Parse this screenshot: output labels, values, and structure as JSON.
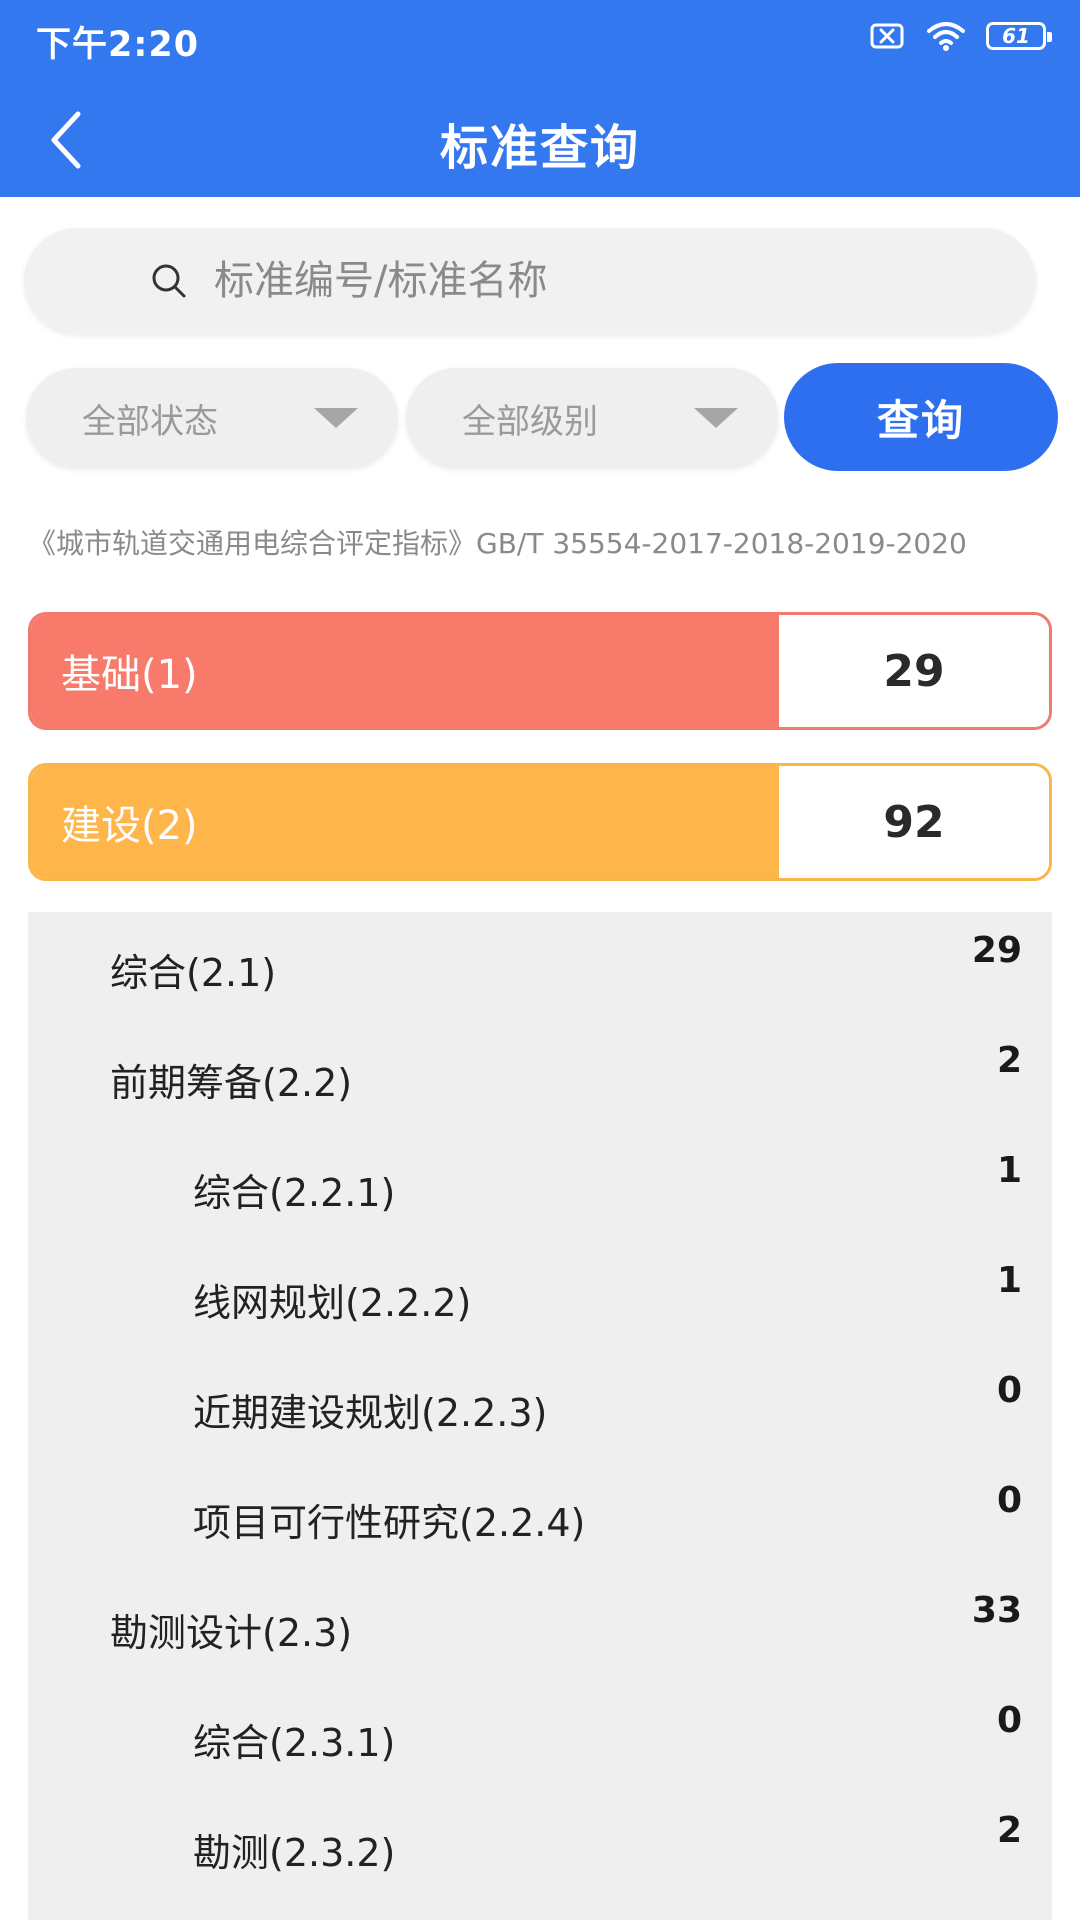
{
  "status_bar": {
    "time": "下午2:20",
    "battery": "61"
  },
  "header": {
    "title": "标准查询"
  },
  "search": {
    "placeholder": "标准编号/标准名称",
    "value": ""
  },
  "filters": {
    "status_label": "全部状态",
    "level_label": "全部级别",
    "query_label": "查询"
  },
  "standard_name": "《城市轨道交通用电综合评定指标》GB/T 35554-2017-2018-2019-2020",
  "categories": [
    {
      "label": "基础(1)",
      "count": "29",
      "color": "#f77a6b"
    },
    {
      "label": "建设(2)",
      "count": "92",
      "color": "#feb64b"
    }
  ],
  "sub_items": [
    {
      "label": "综合(2.1)",
      "count": "29"
    },
    {
      "label": "前期筹备(2.2)",
      "count": "2"
    },
    {
      "label": "综合(2.2.1)",
      "count": "1"
    },
    {
      "label": "线网规划(2.2.2)",
      "count": "1"
    },
    {
      "label": "近期建设规划(2.2.3)",
      "count": "0"
    },
    {
      "label": "项目可行性研究(2.2.4)",
      "count": "0"
    },
    {
      "label": "勘测设计(2.3)",
      "count": "33"
    },
    {
      "label": "综合(2.3.1)",
      "count": "0"
    },
    {
      "label": "勘测(2.3.2)",
      "count": "2"
    }
  ],
  "colors": {
    "primary": "#3478f0",
    "button": "#2e6ff0"
  },
  "icons": {
    "back": "back-arrow-icon",
    "search": "search-icon",
    "caret": "caret-down-icon",
    "sim": "no-sim-icon",
    "wifi": "wifi-icon",
    "battery": "battery-icon"
  }
}
